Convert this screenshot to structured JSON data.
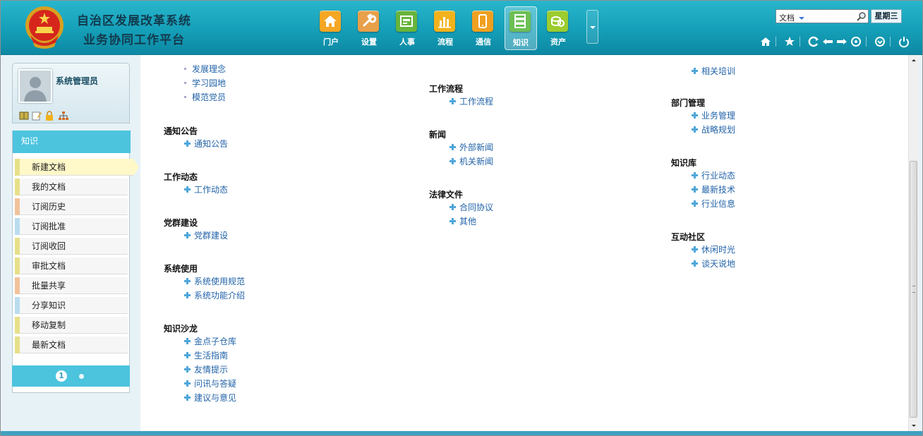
{
  "header": {
    "title_line1": "自治区发展改革系统",
    "title_line2": "业务协同工作平台",
    "nav": [
      {
        "label": "门户",
        "icon": "home-icon",
        "color": "#f5a623"
      },
      {
        "label": "设置",
        "icon": "wrench-icon",
        "color": "#e8a04a"
      },
      {
        "label": "人事",
        "icon": "id-card-icon",
        "color": "#67b43c"
      },
      {
        "label": "流程",
        "icon": "bar-chart-icon",
        "color": "#f2b21c"
      },
      {
        "label": "通信",
        "icon": "mobile-phone-icon",
        "color": "#f0a020"
      },
      {
        "label": "知识",
        "icon": "server-stack-icon",
        "color": "#6cbf54",
        "active": true
      },
      {
        "label": "资产",
        "icon": "coins-icon",
        "color": "#9ccc2e"
      }
    ],
    "search": {
      "category": "文档",
      "placeholder": ""
    },
    "weekday": "星期三",
    "toolbar_icons": [
      "home-icon",
      "star-icon",
      "refresh-icon",
      "back-icon",
      "forward-icon",
      "network-icon",
      "circle-down-icon",
      "power-icon"
    ]
  },
  "sidebar": {
    "user_name": "系统管理员",
    "user_icons": [
      "book-icon",
      "edit-icon",
      "lock-icon",
      "org-chart-icon"
    ],
    "menu_title": "知识",
    "items": [
      {
        "label": "新建文档",
        "tag": "#e6e08a",
        "active": true
      },
      {
        "label": "我的文档",
        "tag": "#e6e08a"
      },
      {
        "label": "订阅历史",
        "tag": "#f2c29a"
      },
      {
        "label": "订阅批准",
        "tag": "#b9dcee"
      },
      {
        "label": "订阅收回",
        "tag": "#e6e08a"
      },
      {
        "label": "审批文档",
        "tag": "#e6e08a"
      },
      {
        "label": "批量共享",
        "tag": "#f2c29a"
      },
      {
        "label": "分享知识",
        "tag": "#b9dcee"
      },
      {
        "label": "移动复制",
        "tag": "#e6e08a"
      },
      {
        "label": "最新文档",
        "tag": "#e6e08a"
      }
    ],
    "pager": {
      "current": "1"
    }
  },
  "content": {
    "col1": {
      "top_links": [
        "发展理念",
        "学习园地",
        "模范党员"
      ],
      "groups": [
        {
          "title": "通知公告",
          "links": [
            "通知公告"
          ]
        },
        {
          "title": "工作动态",
          "links": [
            "工作动态"
          ]
        },
        {
          "title": "党群建设",
          "links": [
            "党群建设"
          ]
        },
        {
          "title": "系统使用",
          "links": [
            "系统使用规范",
            "系统功能介绍"
          ]
        },
        {
          "title": "知识沙龙",
          "links": [
            "金点子仓库",
            "生活指南",
            "友情提示",
            "问讯与答疑",
            "建议与意见"
          ]
        }
      ]
    },
    "col2": {
      "groups": [
        {
          "title": "工作流程",
          "links": [
            "工作流程"
          ]
        },
        {
          "title": "新闻",
          "links": [
            "外部新闻",
            "机关新闻"
          ]
        },
        {
          "title": "法律文件",
          "links": [
            "合同协议",
            "其他"
          ]
        }
      ]
    },
    "col3": {
      "top_links": [
        "相关培训"
      ],
      "groups": [
        {
          "title": "部门管理",
          "links": [
            "业务管理",
            "战略规划"
          ]
        },
        {
          "title": "知识库",
          "links": [
            "行业动态",
            "最新技术",
            "行业信息"
          ]
        },
        {
          "title": "互动社区",
          "links": [
            "休闲时光",
            "谈天说地"
          ]
        }
      ]
    }
  }
}
